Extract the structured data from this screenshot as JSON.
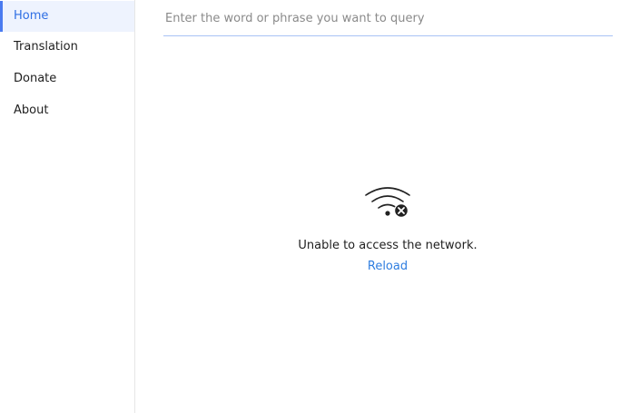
{
  "sidebar": {
    "items": [
      {
        "label": "Home",
        "active": true
      },
      {
        "label": "Translation",
        "active": false
      },
      {
        "label": "Donate",
        "active": false
      },
      {
        "label": "About",
        "active": false
      }
    ]
  },
  "search": {
    "placeholder": "Enter the word or phrase you want to query",
    "value": ""
  },
  "error": {
    "icon": "wifi-off-icon",
    "message": "Unable to access the network.",
    "reload_label": "Reload"
  },
  "colors": {
    "accent": "#2f6fe4",
    "link": "#2f7ee0",
    "active_bg": "#eef3fe"
  }
}
